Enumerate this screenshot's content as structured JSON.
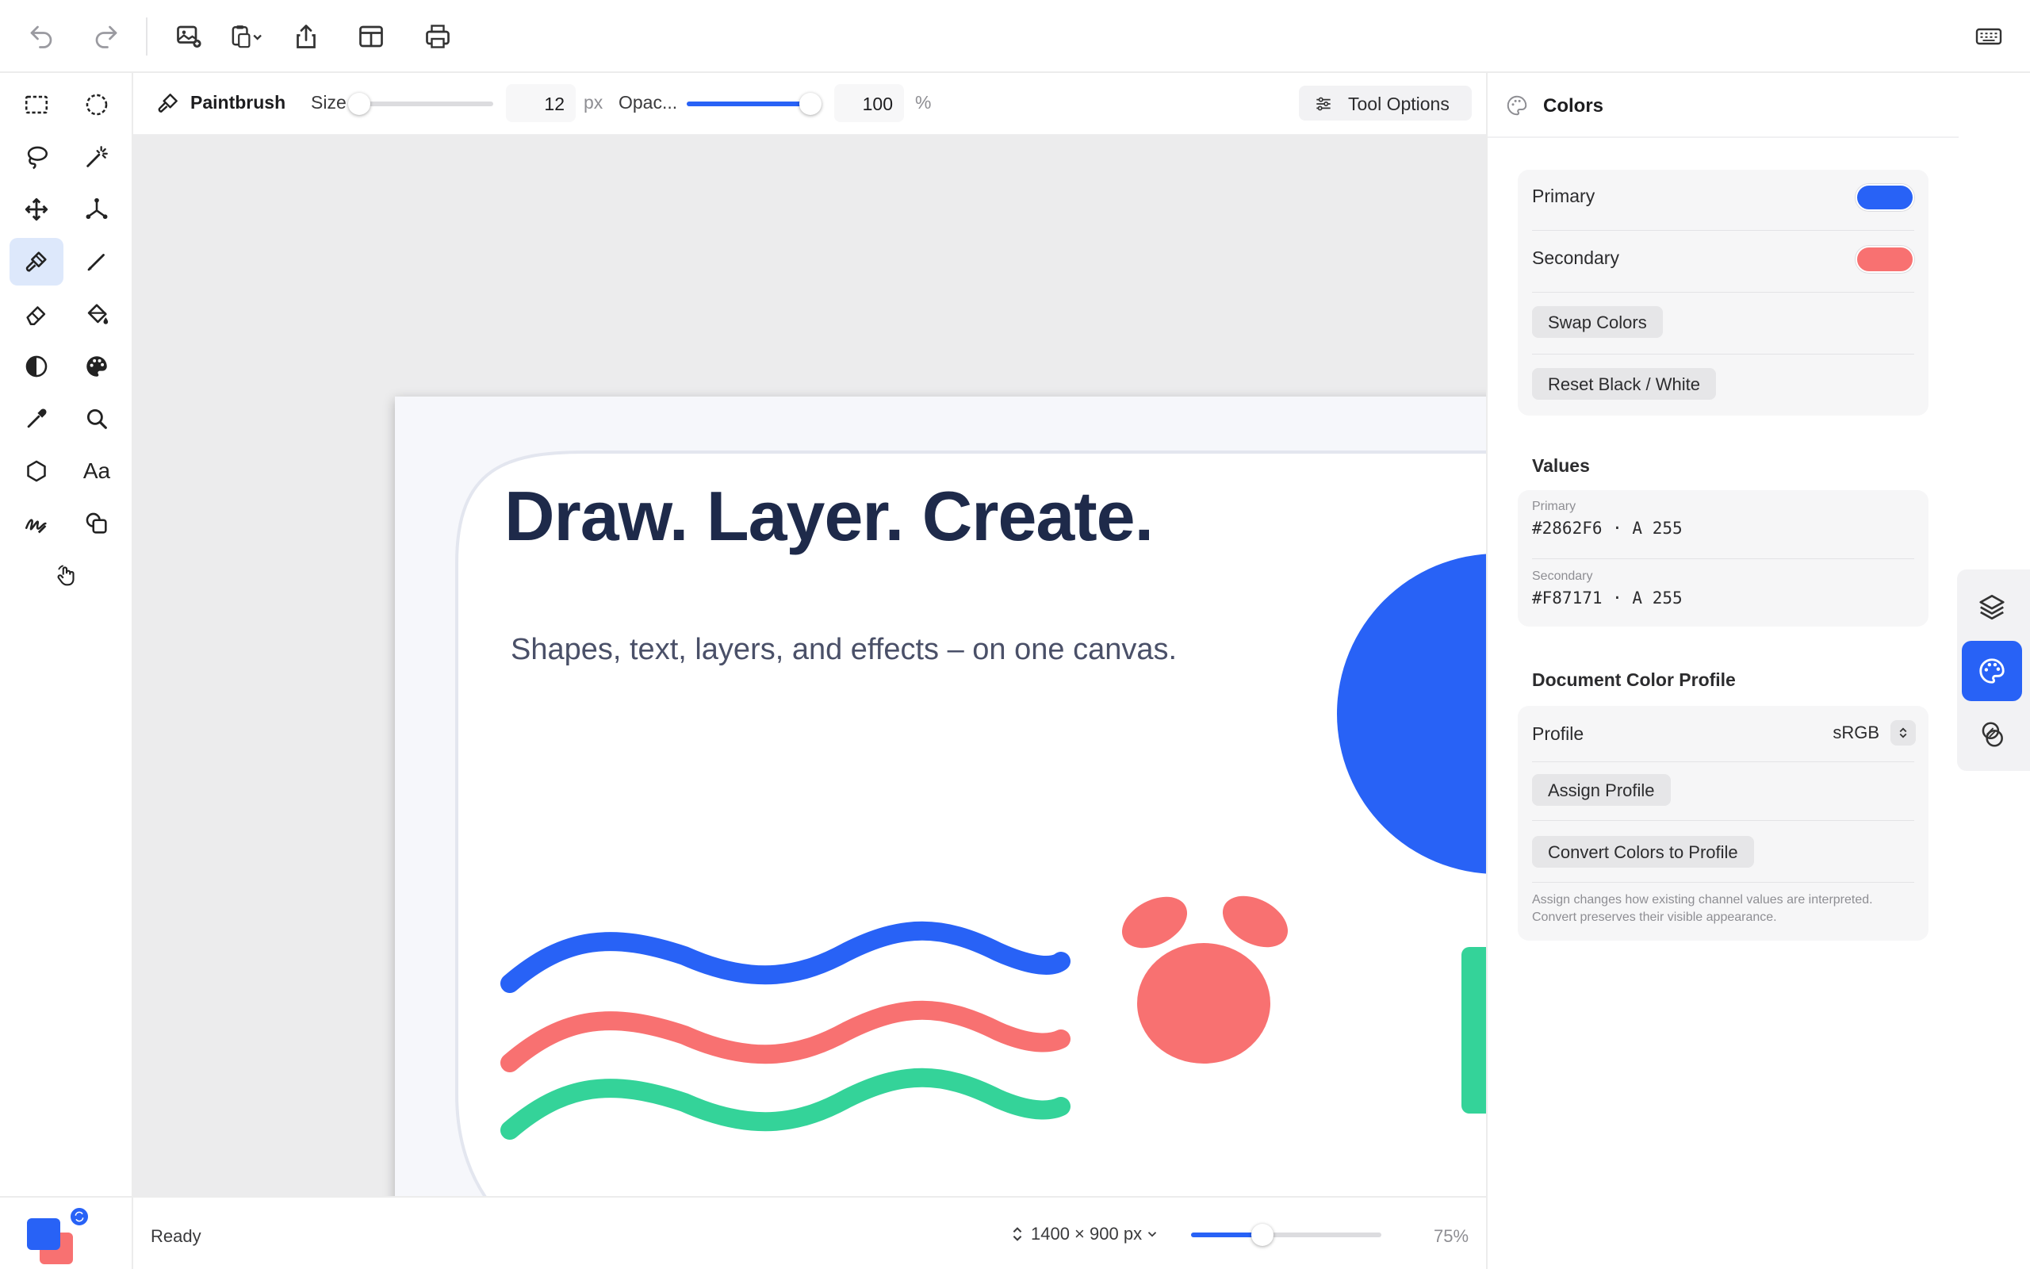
{
  "toolbar": {
    "items": [
      "undo-icon",
      "redo-icon",
      "insert-image-icon",
      "paste-menu-icon",
      "share-icon",
      "layout-icon",
      "print-icon",
      "keyboard-icon"
    ]
  },
  "tools": [
    "rect-select-icon",
    "ellipse-select-icon",
    "lasso-icon",
    "magic-wand-icon",
    "move-icon",
    "transform-icon",
    "paintbrush-icon",
    "pencil-icon",
    "eraser-icon",
    "paint-bucket-icon",
    "contrast-icon",
    "palette-icon",
    "eyedropper-icon",
    "zoom-icon",
    "shape-icon",
    "text-tool-icon",
    "signature-icon",
    "duplicate-icon",
    "hand-icon"
  ],
  "text_tool_label": "Aa",
  "options": {
    "tool_name": "Paintbrush",
    "size_label": "Size",
    "size_value": "12",
    "size_unit": "px",
    "size_level": 0.02,
    "opacity_label": "Opac...",
    "opacity_value": "100",
    "opacity_unit": "%",
    "opacity_level": 1.0,
    "tool_options_label": "Tool Options"
  },
  "canvas": {
    "headline": "Draw. Layer. Create.",
    "subheadline": "Shapes, text, layers, and effects – on one canvas.",
    "colors": {
      "blue": "#2862F6",
      "red": "#F87171",
      "green": "#34D399",
      "gold": "#F5B91F",
      "navy": "#1E2A4A"
    }
  },
  "status": {
    "text": "Ready",
    "dimensions": "1400 × 900 px",
    "zoom_label": "75%",
    "zoom_level": 0.75
  },
  "panel": {
    "title": "Colors",
    "primary_label": "Primary",
    "secondary_label": "Secondary",
    "swap_label": "Swap Colors",
    "reset_label": "Reset Black / White",
    "values_heading": "Values",
    "primary_small": "Primary",
    "primary_value": "#2862F6 · A 255",
    "secondary_small": "Secondary",
    "secondary_value": "#F87171 · A 255",
    "profile_heading": "Document Color Profile",
    "profile_label": "Profile",
    "profile_value": "sRGB",
    "assign_label": "Assign Profile",
    "convert_label": "Convert Colors to Profile",
    "note": "Assign changes how existing channel values are interpreted. Convert preserves their visible appearance.",
    "primary_color": "#2862F6",
    "secondary_color": "#F87171"
  },
  "siderail": [
    "layers-icon",
    "colors-palette-icon",
    "effects-icon"
  ]
}
